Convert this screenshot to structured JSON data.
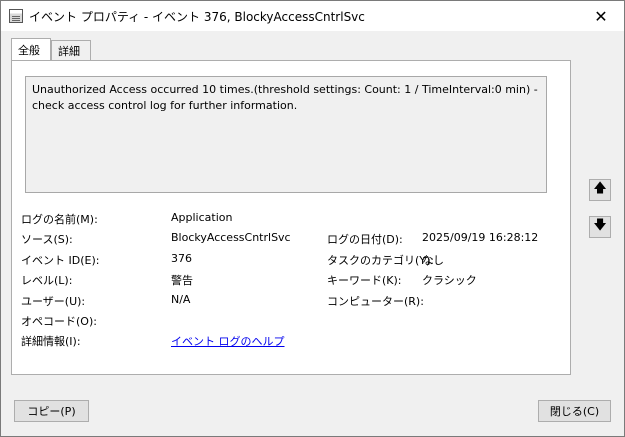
{
  "window": {
    "title": "イベント プロパティ - イベント 376, BlockyAccessCntrlSvc",
    "close_glyph": "✕",
    "app_icon": "event-log-icon"
  },
  "tabs": [
    {
      "label": "全般",
      "active": true
    },
    {
      "label": "詳細",
      "active": false
    }
  ],
  "message": "Unauthorized Access occurred 10 times.(threshold settings: Count: 1 / TimeInterval:0 min)   - check access control log for further information.",
  "fields": {
    "log_name": {
      "label": "ログの名前(M):",
      "value": "Application"
    },
    "source": {
      "label": "ソース(S):",
      "value": "BlockyAccessCntrlSvc"
    },
    "log_date": {
      "label": "ログの日付(D):",
      "value": "2025/09/19 16:28:12"
    },
    "event_id": {
      "label": "イベント ID(E):",
      "value": "376"
    },
    "task_category": {
      "label": "タスクのカテゴリ(Y):",
      "value": "なし"
    },
    "level": {
      "label": "レベル(L):",
      "value": "警告"
    },
    "keywords": {
      "label": "キーワード(K):",
      "value": "クラシック"
    },
    "user": {
      "label": "ユーザー(U):",
      "value": "N/A"
    },
    "computer": {
      "label": "コンピューター(R):",
      "value": ""
    },
    "opcode": {
      "label": "オペコード(O):",
      "value": ""
    },
    "more_info": {
      "label": "詳細情報(I):",
      "value": "イベント ログのヘルプ"
    }
  },
  "nav": {
    "up_glyph": "🡅",
    "down_glyph": "🡇",
    "up_icon": "arrow-up-icon",
    "down_icon": "arrow-down-icon"
  },
  "buttons": {
    "copy": "コピー(P)",
    "close": "閉じる(C)"
  }
}
